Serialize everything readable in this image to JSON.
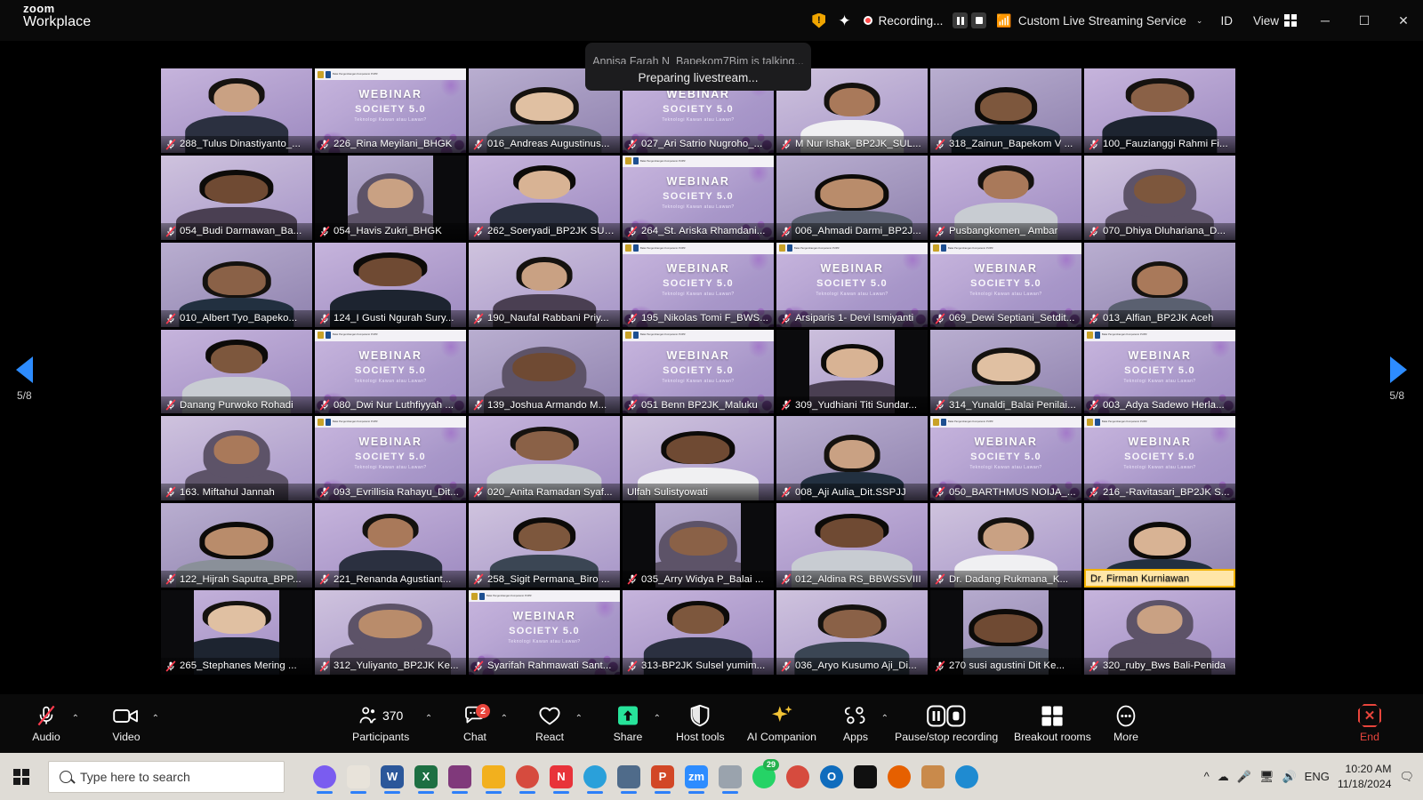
{
  "app": {
    "brand_line1": "zoom",
    "brand_line2": "Workplace"
  },
  "titlebar": {
    "security_icon": "shield-warning-icon",
    "ai_icon": "ai-sparkle-icon",
    "recording_label": "Recording...",
    "pause_recording_icon": "pause-icon",
    "stop_recording_icon": "stop-icon",
    "live_stream_icon": "broadcast-icon",
    "live_stream_label": "Custom Live Streaming Service",
    "live_stream_chevron": "⌄",
    "meeting_id_label": "ID",
    "view_label": "View",
    "view_icon": "grid-view-icon",
    "minimize_icon": "─",
    "maximize_icon": "☐",
    "close_icon": "✕"
  },
  "notifications": {
    "talking_banner": "Annisa Farah N_Bapekom7Bjm is talking...",
    "livestream_toast": "Preparing livestream..."
  },
  "pagination": {
    "prev_icon": "left-arrow-icon",
    "next_icon": "right-arrow-icon",
    "left_page_label": "5/8",
    "right_page_label": "5/8"
  },
  "slide": {
    "title": "WEBINAR",
    "subtitle": "SOCIETY 5.0",
    "tagline": "Teknologi Kawan atau Lawan?",
    "header_text": "Balai Pengembangan Kompetensi PUPR"
  },
  "gallery": {
    "rows": 7,
    "cols": 7,
    "participants": [
      {
        "name": "288_Tulus Dinastiyanto_...",
        "kind": "person",
        "muted": true
      },
      {
        "name": "226_Rina Meyilani_BHGK",
        "kind": "slide",
        "muted": true
      },
      {
        "name": "016_Andreas Augustinus...",
        "kind": "person",
        "muted": true
      },
      {
        "name": "027_Ari Satrio Nugroho_...",
        "kind": "slide",
        "muted": true
      },
      {
        "name": "M Nur Ishak_BP2JK_SUL...",
        "kind": "person",
        "muted": true
      },
      {
        "name": "318_Zainun_Bapekom V ...",
        "kind": "person",
        "muted": true
      },
      {
        "name": "100_Fauzianggi Rahmi Fi...",
        "kind": "person",
        "muted": true
      },
      {
        "name": "054_Budi Darmawan_Ba...",
        "kind": "person",
        "muted": true
      },
      {
        "name": "054_Havis Zukri_BHGK",
        "kind": "person",
        "muted": true,
        "letterbox": true
      },
      {
        "name": "262_Soeryadi_BP2JK SUL...",
        "kind": "person",
        "muted": true
      },
      {
        "name": "264_St. Ariska Rhamdani...",
        "kind": "slide",
        "muted": true
      },
      {
        "name": "006_Ahmadi Darmi_BP2J...",
        "kind": "person",
        "muted": true
      },
      {
        "name": "Pusbangkomen_ Ambar",
        "kind": "person",
        "muted": true
      },
      {
        "name": "070_Dhiya Dluhariana_D...",
        "kind": "person",
        "muted": true
      },
      {
        "name": "010_Albert Tyo_Bapeko...",
        "kind": "person",
        "muted": true
      },
      {
        "name": "124_I Gusti Ngurah Sury...",
        "kind": "person",
        "muted": true
      },
      {
        "name": "190_Naufal Rabbani Priy...",
        "kind": "person",
        "muted": true
      },
      {
        "name": "195_Nikolas Tomi F_BWS...",
        "kind": "slide",
        "muted": true
      },
      {
        "name": "Arsiparis 1- Devi Ismiyanti",
        "kind": "slide",
        "muted": true
      },
      {
        "name": "069_Dewi Septiani_Setdit...",
        "kind": "slide",
        "muted": true
      },
      {
        "name": "013_Alfian_BP2JK Aceh",
        "kind": "person",
        "muted": true
      },
      {
        "name": "Danang Purwoko Rohadi",
        "kind": "person",
        "muted": true
      },
      {
        "name": "080_Dwi Nur Luthfiyyah ...",
        "kind": "slide",
        "muted": true
      },
      {
        "name": "139_Joshua Armando M...",
        "kind": "person",
        "muted": true
      },
      {
        "name": "051 Benn BP2JK_Maluku",
        "kind": "slide",
        "muted": true
      },
      {
        "name": "309_Yudhiani Titi Sundar...",
        "kind": "person",
        "muted": true,
        "letterbox": true
      },
      {
        "name": "314_Yunaldi_Balai Penilai...",
        "kind": "person",
        "muted": true
      },
      {
        "name": "003_Adya Sadewo Herla...",
        "kind": "slide",
        "muted": true
      },
      {
        "name": "163. Miftahul Jannah",
        "kind": "person",
        "muted": true
      },
      {
        "name": "093_Evrillisia Rahayu_Dit...",
        "kind": "slide",
        "muted": true
      },
      {
        "name": "020_Anita Ramadan Syaf...",
        "kind": "person",
        "muted": true
      },
      {
        "name": "Ulfah Sulistyowati",
        "kind": "person",
        "muted": false
      },
      {
        "name": "008_Aji Aulia_Dit.SSPJJ",
        "kind": "person",
        "muted": true
      },
      {
        "name": "050_BARTHMUS NOIJA_...",
        "kind": "slide",
        "muted": true
      },
      {
        "name": "216_-Ravitasari_BP2JK S...",
        "kind": "slide",
        "muted": true
      },
      {
        "name": "122_Hijrah Saputra_BPP...",
        "kind": "person",
        "muted": true
      },
      {
        "name": "221_Renanda Agustiant...",
        "kind": "person",
        "muted": true
      },
      {
        "name": "258_Sigit Permana_Biro ...",
        "kind": "person",
        "muted": true
      },
      {
        "name": "035_Arry Widya P_Balai ...",
        "kind": "person",
        "muted": true,
        "letterbox": true
      },
      {
        "name": "012_Aldina RS_BBWSSVIII",
        "kind": "person",
        "muted": true
      },
      {
        "name": "Dr. Dadang Rukmana_K...",
        "kind": "person",
        "muted": true
      },
      {
        "name": "Dr. Firman Kurniawan",
        "kind": "person",
        "muted": false,
        "highlight": true
      },
      {
        "name": "265_Stephanes Mering ...",
        "kind": "person",
        "muted": true,
        "letterbox": true
      },
      {
        "name": "312_Yuliyanto_BP2JK Ke...",
        "kind": "person",
        "muted": true
      },
      {
        "name": "Syarifah Rahmawati Sant...",
        "kind": "slide",
        "muted": true
      },
      {
        "name": "313-BP2JK Sulsel yumim...",
        "kind": "person",
        "muted": true
      },
      {
        "name": "036_Aryo Kusumo Aji_Di...",
        "kind": "person",
        "muted": true
      },
      {
        "name": "270 susi agustini Dit Ke...",
        "kind": "person",
        "muted": true,
        "letterbox": true
      },
      {
        "name": "320_ruby_Bws Bali-Penida",
        "kind": "person",
        "muted": true
      }
    ]
  },
  "controls": [
    {
      "key": "audio",
      "label": "Audio",
      "icon": "microphone-muted-icon",
      "caret": true
    },
    {
      "key": "video",
      "label": "Video",
      "icon": "camera-icon",
      "caret": true
    },
    {
      "key": "participants",
      "label": "Participants",
      "icon": "people-icon",
      "count": "370",
      "caret": true
    },
    {
      "key": "chat",
      "label": "Chat",
      "icon": "chat-bubble-icon",
      "badge": "2",
      "caret": true
    },
    {
      "key": "react",
      "label": "React",
      "icon": "heart-icon",
      "caret": true
    },
    {
      "key": "share",
      "label": "Share",
      "icon": "share-screen-icon",
      "caret": true
    },
    {
      "key": "host_tools",
      "label": "Host tools",
      "icon": "shield-icon",
      "caret": false
    },
    {
      "key": "ai_companion",
      "label": "AI Companion",
      "icon": "sparkle-icon",
      "caret": false
    },
    {
      "key": "apps",
      "label": "Apps",
      "icon": "apps-icon",
      "caret": true
    },
    {
      "key": "recording",
      "label": "Pause/stop recording",
      "icon": "pause-stop-icon",
      "caret": false
    },
    {
      "key": "breakout",
      "label": "Breakout rooms",
      "icon": "four-squares-icon",
      "caret": false
    },
    {
      "key": "more",
      "label": "More",
      "icon": "ellipsis-icon",
      "caret": false
    }
  ],
  "end_button": {
    "label": "End",
    "icon": "end-call-icon"
  },
  "taskbar": {
    "start_icon": "windows-start-icon",
    "search_placeholder": "Type here to search",
    "search_icon": "magnifier-icon",
    "apps": [
      {
        "name": "copilot-icon",
        "color": "#7a5cf0",
        "glyph": ""
      },
      {
        "name": "paint-icon",
        "color": "#e8e3da",
        "glyph": ""
      },
      {
        "name": "word-icon",
        "color": "#2b579a",
        "glyph": "W"
      },
      {
        "name": "excel-icon",
        "color": "#1d6f42",
        "glyph": "X"
      },
      {
        "name": "onenote-icon",
        "color": "#80397b",
        "glyph": ""
      },
      {
        "name": "file-explorer-icon",
        "color": "#f2b01e",
        "glyph": ""
      },
      {
        "name": "chrome-icon",
        "color": "#d64b3e",
        "glyph": ""
      },
      {
        "name": "opera-gx-icon",
        "color": "#e8333a",
        "glyph": "N"
      },
      {
        "name": "telegram-icon",
        "color": "#2aa0da",
        "glyph": ""
      },
      {
        "name": "calculator-icon",
        "color": "#4f6b8a",
        "glyph": ""
      },
      {
        "name": "powerpoint-icon",
        "color": "#d24726",
        "glyph": "P"
      },
      {
        "name": "zoom-icon",
        "color": "#2d8cff",
        "glyph": "zm"
      },
      {
        "name": "pdf-icon",
        "color": "#9aa3ad",
        "glyph": ""
      },
      {
        "name": "whatsapp-icon",
        "color": "#25d366",
        "glyph": "",
        "badge": "29"
      },
      {
        "name": "chrome-2-icon",
        "color": "#d64b3e",
        "glyph": ""
      },
      {
        "name": "outlook-icon",
        "color": "#0f6cbd",
        "glyph": "O"
      },
      {
        "name": "tiktok-icon",
        "color": "#101010",
        "glyph": ""
      },
      {
        "name": "firefox-icon",
        "color": "#e66000",
        "glyph": ""
      },
      {
        "name": "bag-icon",
        "color": "#c98a4b",
        "glyph": ""
      },
      {
        "name": "edge-icon",
        "color": "#1f8bd1",
        "glyph": ""
      }
    ],
    "tray": {
      "overflow_icon": "^",
      "cloud_icon": "cloud-icon",
      "mic_icon": "microphone-icon",
      "display_icon": "display-icon",
      "volume_icon": "speaker-icon",
      "language_label": "ENG",
      "time": "10:20 AM",
      "date": "11/18/2024",
      "notification_icon": "notification-icon"
    }
  },
  "colors": {
    "accent": "#2d8cff",
    "recording_red": "#ff4a4a",
    "end_red": "#e8453c",
    "badge_red": "#e8453c",
    "live_green": "#3ec66a",
    "highlight_yellow": "#f1b100"
  }
}
